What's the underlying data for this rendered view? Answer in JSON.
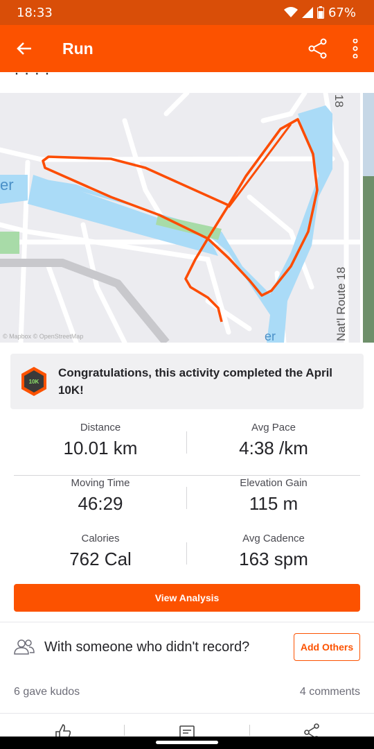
{
  "status_bar": {
    "time": "18:33",
    "battery": "67%"
  },
  "app_bar": {
    "title": "Run"
  },
  "map": {
    "road_label_vertical": "Nat'l Route 18",
    "road_label_top": "18",
    "water_label_left": "er",
    "water_label_bottom": "er",
    "attribution": "© Mapbox © OpenStreetMap"
  },
  "challenge": {
    "badge_text": "10K",
    "message": "Congratulations, this activity completed the April 10K!"
  },
  "stats": [
    {
      "label": "Distance",
      "value": "10.01 km"
    },
    {
      "label": "Avg Pace",
      "value": "4:38 /km"
    },
    {
      "label": "Moving Time",
      "value": "46:29"
    },
    {
      "label": "Elevation Gain",
      "value": "115 m"
    },
    {
      "label": "Calories",
      "value": "762 Cal"
    },
    {
      "label": "Avg Cadence",
      "value": "163 spm"
    }
  ],
  "analysis_button": "View Analysis",
  "others": {
    "prompt": "With someone who didn't record?",
    "button": "Add Others"
  },
  "social": {
    "kudos": "6 gave kudos",
    "comments": "4 comments"
  },
  "colors": {
    "brand": "#fc5200",
    "status_bar": "#d94e08",
    "route": "#fc4c02",
    "water": "#aadbf7"
  },
  "icons": [
    "back-arrow-icon",
    "share-icon",
    "more-vert-icon",
    "people-icon",
    "kudos-thumb-icon",
    "comment-icon",
    "share-nodes-icon"
  ]
}
